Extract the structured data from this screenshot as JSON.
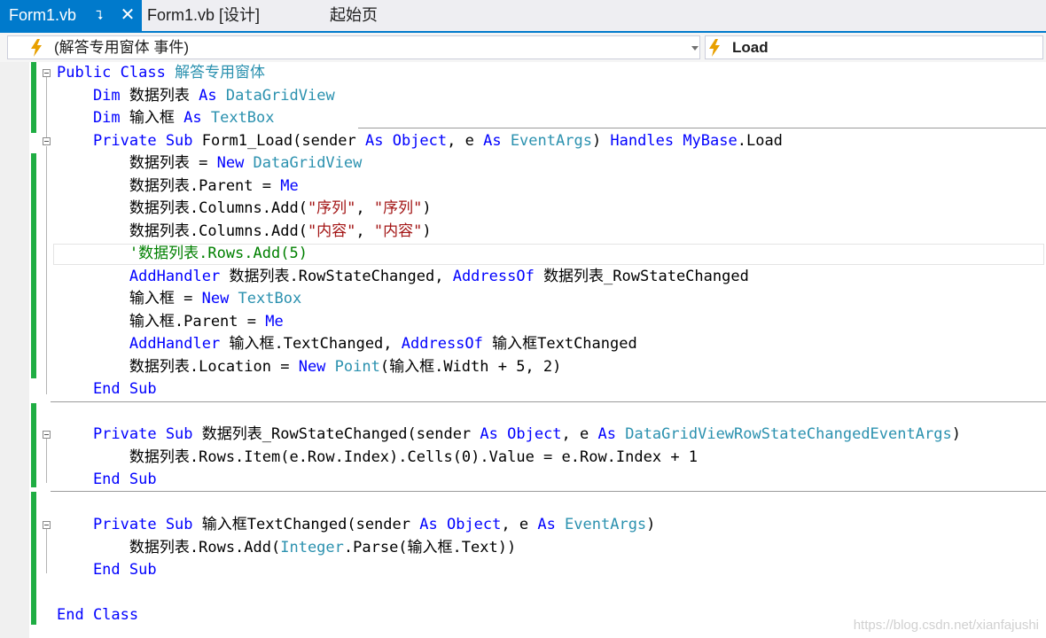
{
  "tabs": [
    {
      "label": "Form1.vb",
      "active": true,
      "pin_icon": "pin-icon",
      "close_icon": "close-icon"
    },
    {
      "label": "Form1.vb [设计]",
      "active": false
    },
    {
      "label": "起始页",
      "active": false
    }
  ],
  "navbar": {
    "left_combo": "(解答专用窗体 事件)",
    "right_combo": "Load",
    "event_icon": "lightning-bolt-icon"
  },
  "colors": {
    "accent": "#007acc",
    "keyword": "#0000ff",
    "type": "#2b91af",
    "string": "#a31515",
    "comment": "#008000",
    "change_bar": "#1fad43"
  },
  "code_lines": [
    [
      {
        "c": "k",
        "t": "Public Class "
      },
      {
        "c": "t",
        "t": "解答专用窗体"
      }
    ],
    [
      {
        "c": "k",
        "t": "    Dim "
      },
      {
        "c": "p",
        "t": "数据列表 "
      },
      {
        "c": "k",
        "t": "As "
      },
      {
        "c": "t",
        "t": "DataGridView"
      }
    ],
    [
      {
        "c": "k",
        "t": "    Dim "
      },
      {
        "c": "p",
        "t": "输入框 "
      },
      {
        "c": "k",
        "t": "As "
      },
      {
        "c": "t",
        "t": "TextBox"
      }
    ],
    [
      {
        "c": "k",
        "t": "    Private Sub "
      },
      {
        "c": "p",
        "t": "Form1_Load(sender "
      },
      {
        "c": "k",
        "t": "As "
      },
      {
        "c": "k",
        "t": "Object"
      },
      {
        "c": "p",
        "t": ", e "
      },
      {
        "c": "k",
        "t": "As "
      },
      {
        "c": "t",
        "t": "EventArgs"
      },
      {
        "c": "p",
        "t": ") "
      },
      {
        "c": "k",
        "t": "Handles "
      },
      {
        "c": "k",
        "t": "MyBase"
      },
      {
        "c": "p",
        "t": ".Load"
      }
    ],
    [
      {
        "c": "p",
        "t": "        数据列表 = "
      },
      {
        "c": "k",
        "t": "New "
      },
      {
        "c": "t",
        "t": "DataGridView"
      }
    ],
    [
      {
        "c": "p",
        "t": "        数据列表.Parent = "
      },
      {
        "c": "k",
        "t": "Me"
      }
    ],
    [
      {
        "c": "p",
        "t": "        数据列表.Columns.Add("
      },
      {
        "c": "s",
        "t": "\"序列\""
      },
      {
        "c": "p",
        "t": ", "
      },
      {
        "c": "s",
        "t": "\"序列\""
      },
      {
        "c": "p",
        "t": ")"
      }
    ],
    [
      {
        "c": "p",
        "t": "        数据列表.Columns.Add("
      },
      {
        "c": "s",
        "t": "\"内容\""
      },
      {
        "c": "p",
        "t": ", "
      },
      {
        "c": "s",
        "t": "\"内容\""
      },
      {
        "c": "p",
        "t": ")"
      }
    ],
    [
      {
        "c": "c",
        "t": "        '数据列表.Rows.Add(5)"
      }
    ],
    [
      {
        "c": "k",
        "t": "        AddHandler "
      },
      {
        "c": "p",
        "t": "数据列表.RowStateChanged, "
      },
      {
        "c": "k",
        "t": "AddressOf "
      },
      {
        "c": "p",
        "t": "数据列表_RowStateChanged"
      }
    ],
    [
      {
        "c": "p",
        "t": "        输入框 = "
      },
      {
        "c": "k",
        "t": "New "
      },
      {
        "c": "t",
        "t": "TextBox"
      }
    ],
    [
      {
        "c": "p",
        "t": "        输入框.Parent = "
      },
      {
        "c": "k",
        "t": "Me"
      }
    ],
    [
      {
        "c": "k",
        "t": "        AddHandler "
      },
      {
        "c": "p",
        "t": "输入框.TextChanged, "
      },
      {
        "c": "k",
        "t": "AddressOf "
      },
      {
        "c": "p",
        "t": "输入框TextChanged"
      }
    ],
    [
      {
        "c": "p",
        "t": "        数据列表.Location = "
      },
      {
        "c": "k",
        "t": "New "
      },
      {
        "c": "t",
        "t": "Point"
      },
      {
        "c": "p",
        "t": "(输入框.Width + 5, 2)"
      }
    ],
    [
      {
        "c": "k",
        "t": "    End Sub"
      }
    ],
    [],
    [
      {
        "c": "k",
        "t": "    Private Sub "
      },
      {
        "c": "p",
        "t": "数据列表_RowStateChanged(sender "
      },
      {
        "c": "k",
        "t": "As "
      },
      {
        "c": "k",
        "t": "Object"
      },
      {
        "c": "p",
        "t": ", e "
      },
      {
        "c": "k",
        "t": "As "
      },
      {
        "c": "t",
        "t": "DataGridViewRowStateChangedEventArgs"
      },
      {
        "c": "p",
        "t": ")"
      }
    ],
    [
      {
        "c": "p",
        "t": "        数据列表.Rows.Item(e.Row.Index).Cells(0).Value = e.Row.Index + 1"
      }
    ],
    [
      {
        "c": "k",
        "t": "    End Sub"
      }
    ],
    [],
    [
      {
        "c": "k",
        "t": "    Private Sub "
      },
      {
        "c": "p",
        "t": "输入框TextChanged(sender "
      },
      {
        "c": "k",
        "t": "As "
      },
      {
        "c": "k",
        "t": "Object"
      },
      {
        "c": "p",
        "t": ", e "
      },
      {
        "c": "k",
        "t": "As "
      },
      {
        "c": "t",
        "t": "EventArgs"
      },
      {
        "c": "p",
        "t": ")"
      }
    ],
    [
      {
        "c": "p",
        "t": "        数据列表.Rows.Add("
      },
      {
        "c": "t",
        "t": "Integer"
      },
      {
        "c": "p",
        "t": ".Parse(输入框.Text))"
      }
    ],
    [
      {
        "c": "k",
        "t": "    End Sub"
      }
    ],
    [],
    [
      {
        "c": "k",
        "t": "End Class"
      }
    ]
  ],
  "watermark": "https://blog.csdn.net/xianfajushi"
}
